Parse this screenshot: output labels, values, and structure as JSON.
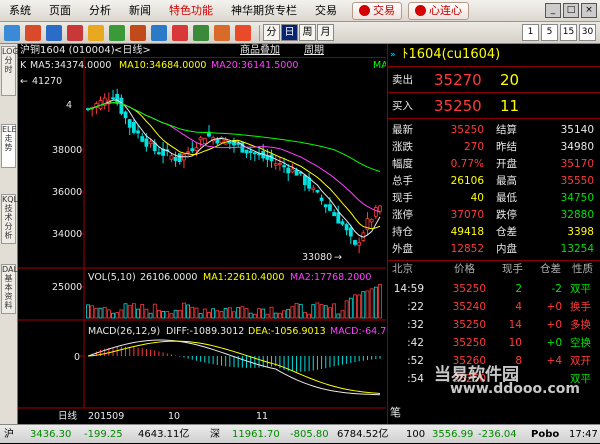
{
  "menu": {
    "items": [
      "系统",
      "页面",
      "分析",
      "新闻",
      "特色功能",
      "神华期货专栏",
      "交易"
    ],
    "trade_button": "交易",
    "heart_button": "心连心"
  },
  "toolbar": {
    "period_buttons": [
      "分",
      "日",
      "周",
      "月",
      "1",
      "5",
      "15",
      "30"
    ],
    "active_period": "日"
  },
  "left_tabs": [
    "LOG 分时",
    "ELE 走势",
    "KQL 技术分析",
    "DAL 基本资料"
  ],
  "chart": {
    "symbol": "沪铜1604 (010004)",
    "period_label": "日线",
    "overlay_label": "商品叠加",
    "cycle_label": "周期",
    "ma_line": {
      "k": "K",
      "ma5": "MA5:34374.0000",
      "ma10": "MA10:34684.0000",
      "ma20": "MA20:36141.5000",
      "ma60": "MA6"
    },
    "high_label": "41270",
    "low_label": "33080",
    "y_ticks": [
      "4",
      "38000",
      "36000",
      "34000"
    ],
    "vol_line": {
      "vol": "VOL(5,10)",
      "v": "26106.0000",
      "ma1": "MA1:22610.4000",
      "ma2": "MA2:17768.2000"
    },
    "vol_tick": "25000",
    "macd_line": {
      "name": "MACD(26,12,9)",
      "diff": "DIFF:-1089.3012",
      "dea": "DEA:-1056.9013",
      "macd": "MACD:-64.7"
    },
    "macd_tick": "0",
    "date_axis": [
      "日线",
      "201509",
      "10",
      "11"
    ]
  },
  "chart_data": {
    "type": "candlestick",
    "title": "沪铜1604 (010004) 日线",
    "price_range": [
      32500,
      42500
    ],
    "labeled_high": 41270,
    "labeled_low": 33080,
    "last_close": 35270,
    "y_ticks": [
      38000,
      36000,
      34000
    ],
    "volume_tick": 25000,
    "macd": {
      "diff": -1089.3012,
      "dea": -1056.9013
    }
  },
  "quote": {
    "title": "ﾄ1604(cu1604)",
    "ask_label": "卖出",
    "ask_price": "35270",
    "ask_vol": "20",
    "bid_label": "买入",
    "bid_price": "35250",
    "bid_vol": "11",
    "rows": [
      {
        "l1": "最新",
        "v1": "35250",
        "c1": "red",
        "l2": "结算",
        "v2": "35140",
        "c2": "wht"
      },
      {
        "l1": "涨跌",
        "v1": "270",
        "c1": "red",
        "l2": "昨结",
        "v2": "34980",
        "c2": "wht"
      },
      {
        "l1": "幅度",
        "v1": "0.77%",
        "c1": "red",
        "l2": "开盘",
        "v2": "35170",
        "c2": "red"
      },
      {
        "l1": "总手",
        "v1": "26106",
        "c1": "yel",
        "l2": "最高",
        "v2": "35550",
        "c2": "red"
      },
      {
        "l1": "现手",
        "v1": "40",
        "c1": "yel",
        "l2": "最低",
        "v2": "34750",
        "c2": "grn"
      },
      {
        "l1": "涨停",
        "v1": "37070",
        "c1": "red",
        "l2": "跌停",
        "v2": "32880",
        "c2": "grn"
      },
      {
        "l1": "持仓",
        "v1": "49418",
        "c1": "yel",
        "l2": "仓差",
        "v2": "3398",
        "c2": "yel"
      },
      {
        "l1": "外盘",
        "v1": "12852",
        "c1": "red",
        "l2": "内盘",
        "v2": "13254",
        "c2": "grn"
      }
    ]
  },
  "ticks": {
    "headers": [
      "北京",
      "价格",
      "现手",
      "仓差",
      "性质"
    ],
    "rows": [
      {
        "time": "14:59",
        "price": "35250",
        "vol": "2",
        "oi": "-2",
        "nature": "双平",
        "pc": "red",
        "nc": "grn",
        "oc": "grn"
      },
      {
        "time": ":22",
        "price": "35240",
        "vol": "4",
        "oi": "+0",
        "nature": "换手",
        "pc": "red",
        "nc": "red",
        "oc": "red"
      },
      {
        "time": ":32",
        "price": "35250",
        "vol": "14",
        "oi": "+0",
        "nature": "多换",
        "pc": "red",
        "nc": "red",
        "oc": "red"
      },
      {
        "time": ":42",
        "price": "35250",
        "vol": "10",
        "oi": "+0",
        "nature": "空换",
        "pc": "red",
        "nc": "grn",
        "oc": "red"
      },
      {
        "time": ":52",
        "price": "35260",
        "vol": "8",
        "oi": "+4",
        "nature": "双开",
        "pc": "red",
        "nc": "red",
        "oc": "red"
      },
      {
        "time": ":54",
        "price": "35250",
        "vol": "",
        "oi": "",
        "nature": "双平",
        "pc": "red",
        "nc": "grn",
        "oc": "red"
      }
    ],
    "footer": "笔"
  },
  "status": {
    "i1_name": "沪",
    "i1_val": "3436.30",
    "i1_chg": "-199.25",
    "i1_amt": "4643.11亿",
    "i2_name": "深",
    "i2_val": "11961.70",
    "i2_chg": "-805.80",
    "i2_amt": "6784.52亿",
    "i3_name": "100",
    "i3_val": "3556.99",
    "i3_chg": "-236.04",
    "pobo": "Pobo",
    "time": "17:47"
  },
  "watermark": {
    "line1": "当易软件园",
    "line2": "www.ddooo.com"
  }
}
